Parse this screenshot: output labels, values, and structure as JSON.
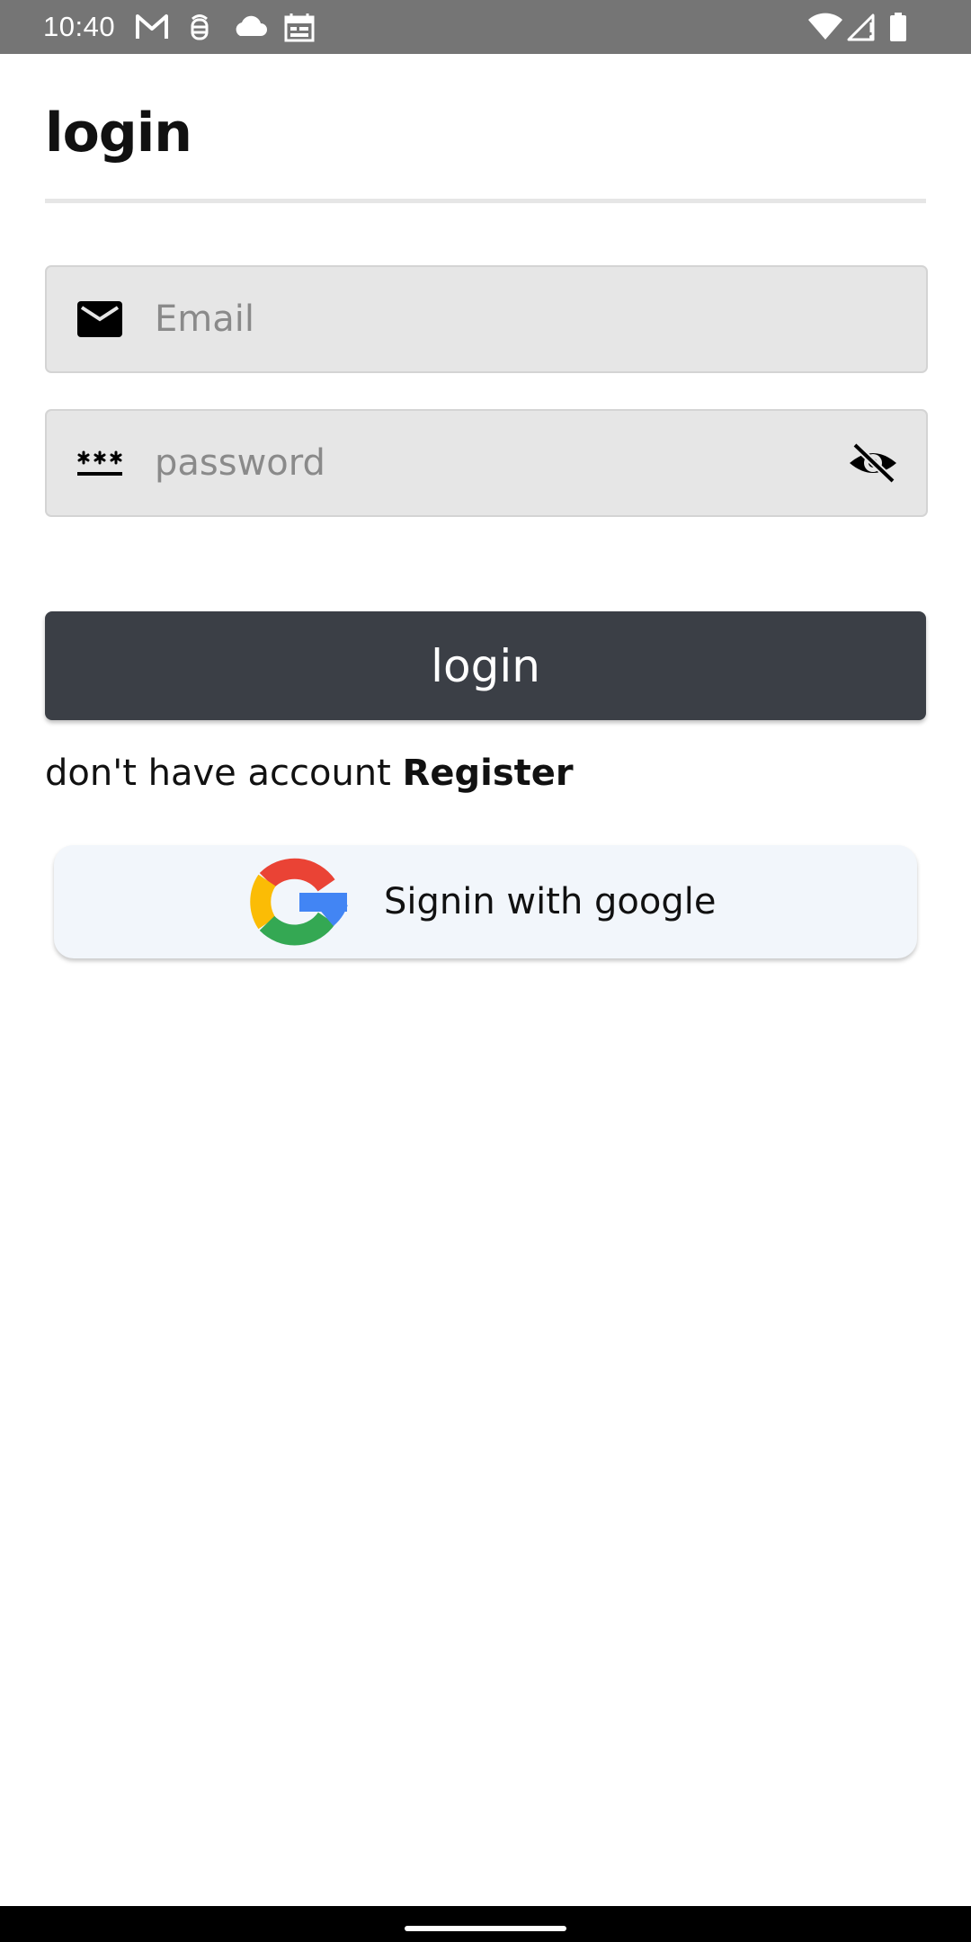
{
  "status_bar": {
    "time": "10:40",
    "icons": [
      "gmail-icon",
      "debug-icon",
      "cloud-icon",
      "calendar-icon",
      "wifi-icon",
      "cellular-signal-icon",
      "battery-icon"
    ]
  },
  "page": {
    "title": "login"
  },
  "form": {
    "email": {
      "placeholder": "Email",
      "value": "",
      "icon": "mail-icon"
    },
    "password": {
      "placeholder": "password",
      "value": "",
      "icon": "password-icon",
      "toggle_icon": "visibility-off-icon"
    },
    "login_label": "login"
  },
  "register": {
    "prompt": "don't have account ",
    "link_label": "Register"
  },
  "google": {
    "label": "Signin with google",
    "icon": "google-logo"
  },
  "colors": {
    "status_bar": "#757575",
    "field_background": "#e6e6e6",
    "login_button": "#3b3f46",
    "google_button": "#f2f6fb",
    "nav_bar": "#000000"
  }
}
